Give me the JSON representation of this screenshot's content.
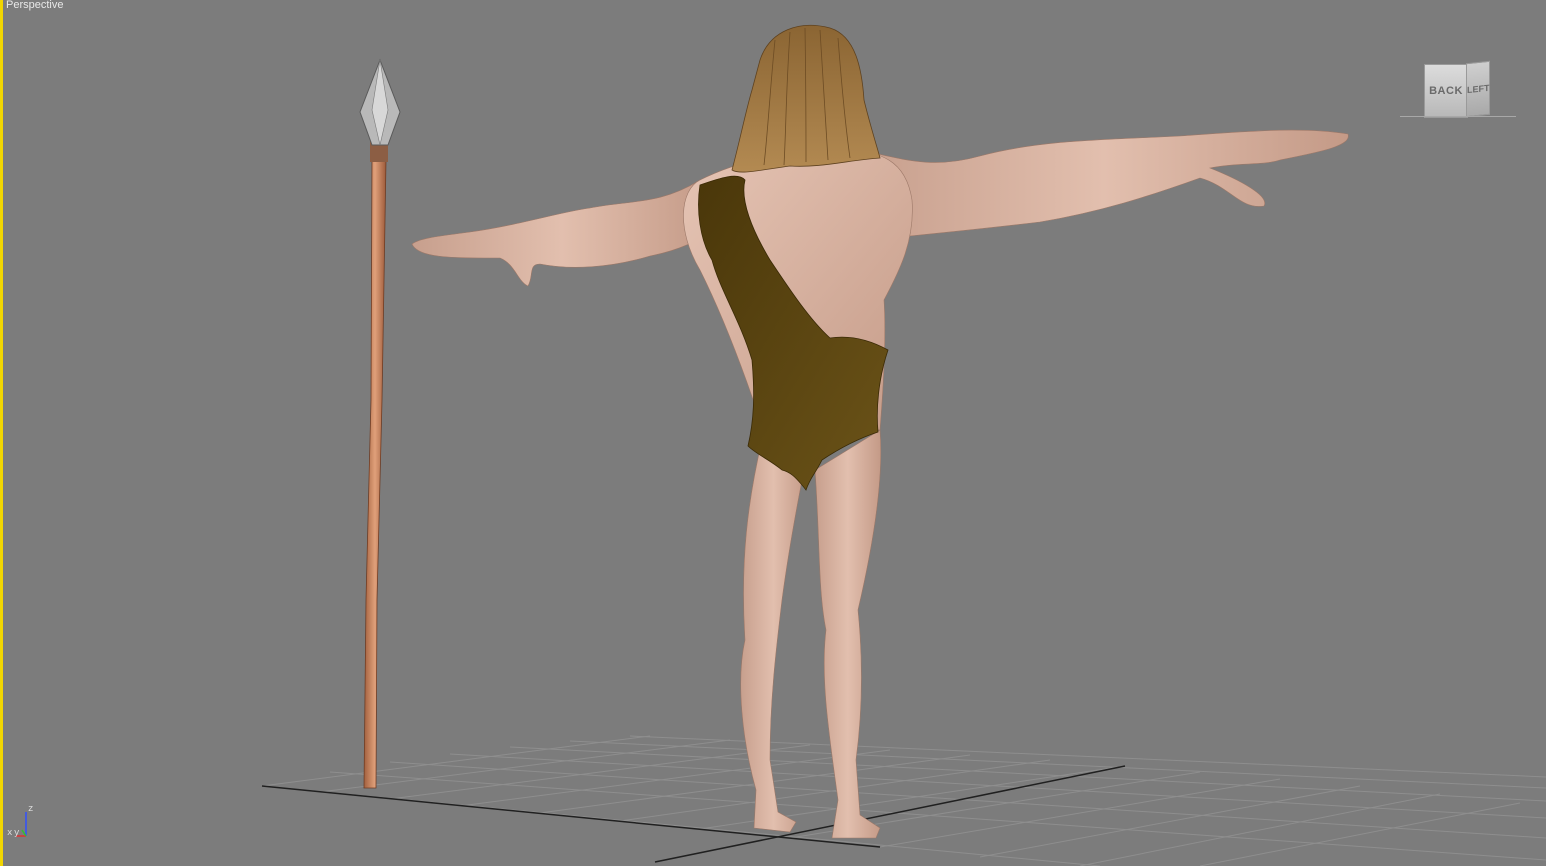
{
  "viewport": {
    "label": "Perspective",
    "background": "#7c7c7c",
    "active_border_color": "#f2d600"
  },
  "viewcube": {
    "back_label": "BACK",
    "left_label": "LEFT"
  },
  "axis_tripod": {
    "x_label": "x",
    "y_label": "y",
    "z_label": "z",
    "x_color": "#e03030",
    "y_color": "#30c030",
    "z_color": "#3050ff"
  },
  "scene": {
    "skin_color": "#d9b29f",
    "cloth_color": "#5a4410",
    "hair_color": "#9a6f3a",
    "spear_shaft_color": "#c98058",
    "spear_head_color": "#b5b5b5",
    "grid_color": "#8d8d8d"
  }
}
